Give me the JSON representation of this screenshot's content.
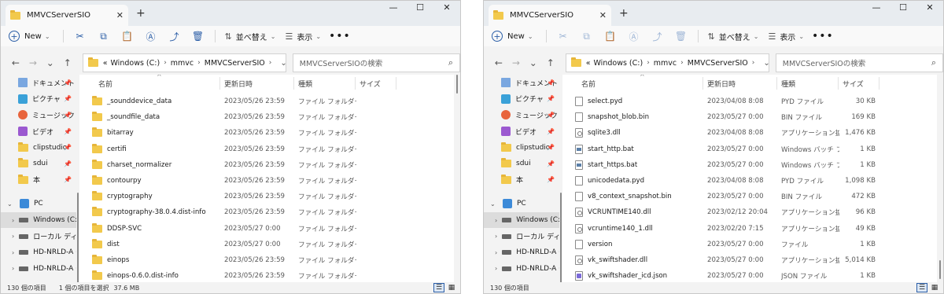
{
  "windows": [
    {
      "title": "MMVCServerSIO",
      "toolbar": {
        "new_label": "New",
        "sort_label": "並べ替え",
        "view_label": "表示"
      },
      "address": {
        "prefix": "«",
        "crumbs": [
          "Windows (C:)",
          "mmvc",
          "MMVCServerSIO"
        ]
      },
      "search_placeholder": "MMVCServerSIOの検索",
      "sidebar": [
        {
          "label": "ドキュメント",
          "icon": "documents-icon",
          "pinned": true
        },
        {
          "label": "ピクチャ",
          "icon": "pictures-icon",
          "pinned": true
        },
        {
          "label": "ミュージック",
          "icon": "music-icon",
          "pinned": true
        },
        {
          "label": "ビデオ",
          "icon": "videos-icon",
          "pinned": true
        },
        {
          "label": "clipstudio",
          "icon": "folder-icon",
          "pinned": true
        },
        {
          "label": "sdui",
          "icon": "folder-icon",
          "pinned": true
        },
        {
          "label": "本",
          "icon": "folder-icon",
          "pinned": true
        }
      ],
      "tree": [
        {
          "label": "PC",
          "expanded": true
        },
        {
          "label": "Windows (C:)",
          "selected": true
        },
        {
          "label": "ローカル ディスク"
        },
        {
          "label": "HD-NRLD-A (G:"
        },
        {
          "label": "HD-NRLD-A (G:"
        }
      ],
      "columns": {
        "name": "名前",
        "date": "更新日時",
        "type": "種類",
        "size": "サイズ"
      },
      "files": [
        {
          "name": "_sounddevice_data",
          "date": "2023/05/26 23:59",
          "type": "ファイル フォルダー",
          "size": "",
          "kind": "folder"
        },
        {
          "name": "_soundfile_data",
          "date": "2023/05/26 23:59",
          "type": "ファイル フォルダー",
          "size": "",
          "kind": "folder"
        },
        {
          "name": "bitarray",
          "date": "2023/05/26 23:59",
          "type": "ファイル フォルダー",
          "size": "",
          "kind": "folder"
        },
        {
          "name": "certifi",
          "date": "2023/05/26 23:59",
          "type": "ファイル フォルダー",
          "size": "",
          "kind": "folder"
        },
        {
          "name": "charset_normalizer",
          "date": "2023/05/26 23:59",
          "type": "ファイル フォルダー",
          "size": "",
          "kind": "folder"
        },
        {
          "name": "contourpy",
          "date": "2023/05/26 23:59",
          "type": "ファイル フォルダー",
          "size": "",
          "kind": "folder"
        },
        {
          "name": "cryptography",
          "date": "2023/05/26 23:59",
          "type": "ファイル フォルダー",
          "size": "",
          "kind": "folder"
        },
        {
          "name": "cryptography-38.0.4.dist-info",
          "date": "2023/05/26 23:59",
          "type": "ファイル フォルダー",
          "size": "",
          "kind": "folder"
        },
        {
          "name": "DDSP-SVC",
          "date": "2023/05/27 0:00",
          "type": "ファイル フォルダー",
          "size": "",
          "kind": "folder"
        },
        {
          "name": "dist",
          "date": "2023/05/27 0:00",
          "type": "ファイル フォルダー",
          "size": "",
          "kind": "folder"
        },
        {
          "name": "einops",
          "date": "2023/05/26 23:59",
          "type": "ファイル フォルダー",
          "size": "",
          "kind": "folder"
        },
        {
          "name": "einops-0.6.0.dist-info",
          "date": "2023/05/26 23:59",
          "type": "ファイル フォルダー",
          "size": "",
          "kind": "folder"
        }
      ],
      "status": {
        "count": "130 個の項目",
        "selection": "1 個の項目を選択",
        "size": "37.6 MB"
      },
      "scroll_position": 0.0
    },
    {
      "title": "MMVCServerSIO",
      "toolbar": {
        "new_label": "New",
        "sort_label": "並べ替え",
        "view_label": "表示"
      },
      "address": {
        "prefix": "«",
        "crumbs": [
          "Windows (C:)",
          "mmvc",
          "MMVCServerSIO"
        ]
      },
      "search_placeholder": "MMVCServerSIOの検索",
      "sidebar": [
        {
          "label": "ドキュメント",
          "icon": "documents-icon",
          "pinned": true
        },
        {
          "label": "ピクチャ",
          "icon": "pictures-icon",
          "pinned": true
        },
        {
          "label": "ミュージック",
          "icon": "music-icon",
          "pinned": true
        },
        {
          "label": "ビデオ",
          "icon": "videos-icon",
          "pinned": true
        },
        {
          "label": "clipstudio",
          "icon": "folder-icon",
          "pinned": true
        },
        {
          "label": "sdui",
          "icon": "folder-icon",
          "pinned": true
        },
        {
          "label": "本",
          "icon": "folder-icon",
          "pinned": true
        }
      ],
      "tree": [
        {
          "label": "PC",
          "expanded": true
        },
        {
          "label": "Windows (C:)",
          "selected": true
        },
        {
          "label": "ローカル ディスク"
        },
        {
          "label": "HD-NRLD-A (G:"
        },
        {
          "label": "HD-NRLD-A (G:"
        }
      ],
      "columns": {
        "name": "名前",
        "date": "更新日時",
        "type": "種類",
        "size": "サイズ"
      },
      "files": [
        {
          "name": "select.pyd",
          "date": "2023/04/08 8:08",
          "type": "PYD ファイル",
          "size": "30 KB",
          "kind": "file"
        },
        {
          "name": "snapshot_blob.bin",
          "date": "2023/05/27 0:00",
          "type": "BIN ファイル",
          "size": "169 KB",
          "kind": "file"
        },
        {
          "name": "sqlite3.dll",
          "date": "2023/04/08 8:08",
          "type": "アプリケーション拡張",
          "size": "1,476 KB",
          "kind": "dll"
        },
        {
          "name": "start_http.bat",
          "date": "2023/05/27 0:00",
          "type": "Windows バッチ ファ...",
          "size": "1 KB",
          "kind": "bat"
        },
        {
          "name": "start_https.bat",
          "date": "2023/05/27 0:00",
          "type": "Windows バッチ ファ...",
          "size": "1 KB",
          "kind": "bat"
        },
        {
          "name": "unicodedata.pyd",
          "date": "2023/04/08 8:08",
          "type": "PYD ファイル",
          "size": "1,098 KB",
          "kind": "file"
        },
        {
          "name": "v8_context_snapshot.bin",
          "date": "2023/05/27 0:00",
          "type": "BIN ファイル",
          "size": "472 KB",
          "kind": "file"
        },
        {
          "name": "VCRUNTIME140.dll",
          "date": "2023/02/12 20:04",
          "type": "アプリケーション拡張",
          "size": "96 KB",
          "kind": "dll"
        },
        {
          "name": "vcruntime140_1.dll",
          "date": "2023/02/20 7:15",
          "type": "アプリケーション拡張",
          "size": "49 KB",
          "kind": "dll"
        },
        {
          "name": "version",
          "date": "2023/05/27 0:00",
          "type": "ファイル",
          "size": "1 KB",
          "kind": "file"
        },
        {
          "name": "vk_swiftshader.dll",
          "date": "2023/05/27 0:00",
          "type": "アプリケーション拡張",
          "size": "5,014 KB",
          "kind": "dll"
        },
        {
          "name": "vk_swiftshader_icd.json",
          "date": "2023/05/27 0:00",
          "type": "JSON ファイル",
          "size": "1 KB",
          "kind": "json"
        }
      ],
      "status": {
        "count": "130 個の項目",
        "selection": "",
        "size": ""
      },
      "scroll_position": 1.0
    }
  ],
  "icons": {
    "cut": "✂",
    "copy": "⧉",
    "paste": "📋",
    "rename": "Ⓐ",
    "share": "⤴",
    "delete": "🗑",
    "back": "←",
    "forward": "→",
    "up": "↑",
    "recent": "⌄",
    "refresh": "↻",
    "search": "⌕",
    "sort": "⇅",
    "view": "☰",
    "more": "•••",
    "minimize": "—",
    "maximize": "☐",
    "close": "✕",
    "add_tab": "+",
    "pin": "📌",
    "expand": "›",
    "collapse": "⌄",
    "sort_up": "^",
    "details_view": "☰",
    "tiles_view": "▦"
  },
  "colors": {
    "accent": "#2b5ea7",
    "folder": "#f2c94c",
    "selection": "#dcdcdc"
  }
}
